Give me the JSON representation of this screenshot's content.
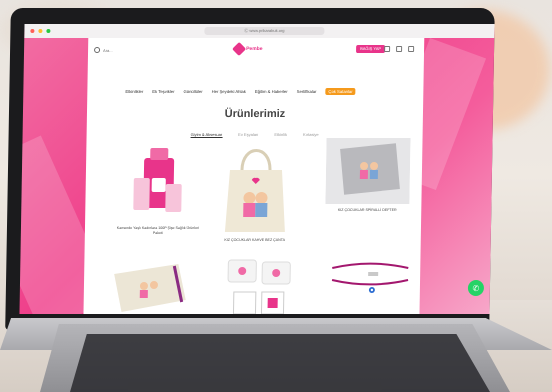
{
  "browser": {
    "url": "Ⓒ www.prikarabuk.org"
  },
  "header": {
    "search_placeholder": "Ara...",
    "logo_text": "Pembe",
    "donate_label": "BAĞIŞ YAP"
  },
  "nav": {
    "items": [
      "Etkinlikler",
      "Ek Teşvikler",
      "Gönüllüler",
      "Her Şeydeki Ahlak",
      "Eğitim & Haberler",
      "Sertifikalar"
    ],
    "tag_label": "Çok Satanlar"
  },
  "main": {
    "title": "Ürünlerimiz",
    "filters": [
      "Giyim & Aksesuar",
      "Ev Eşyaları",
      "Etkinlik",
      "Kırtasiye"
    ]
  },
  "products": [
    {
      "caption": "Kanserde Yaşlı Kadınlara 100P Şişe Sağlık Ürünleri Paketi"
    },
    {
      "caption": "KIZ ÇOCUKLAR KAHVE BEZ ÇANTA"
    },
    {
      "caption": "KIZ ÇOCUKLAR SPİRALLİ DEFTER"
    }
  ],
  "colors": {
    "brand": "#e8348a",
    "accent": "#f59a1c",
    "chat": "#25d366"
  }
}
